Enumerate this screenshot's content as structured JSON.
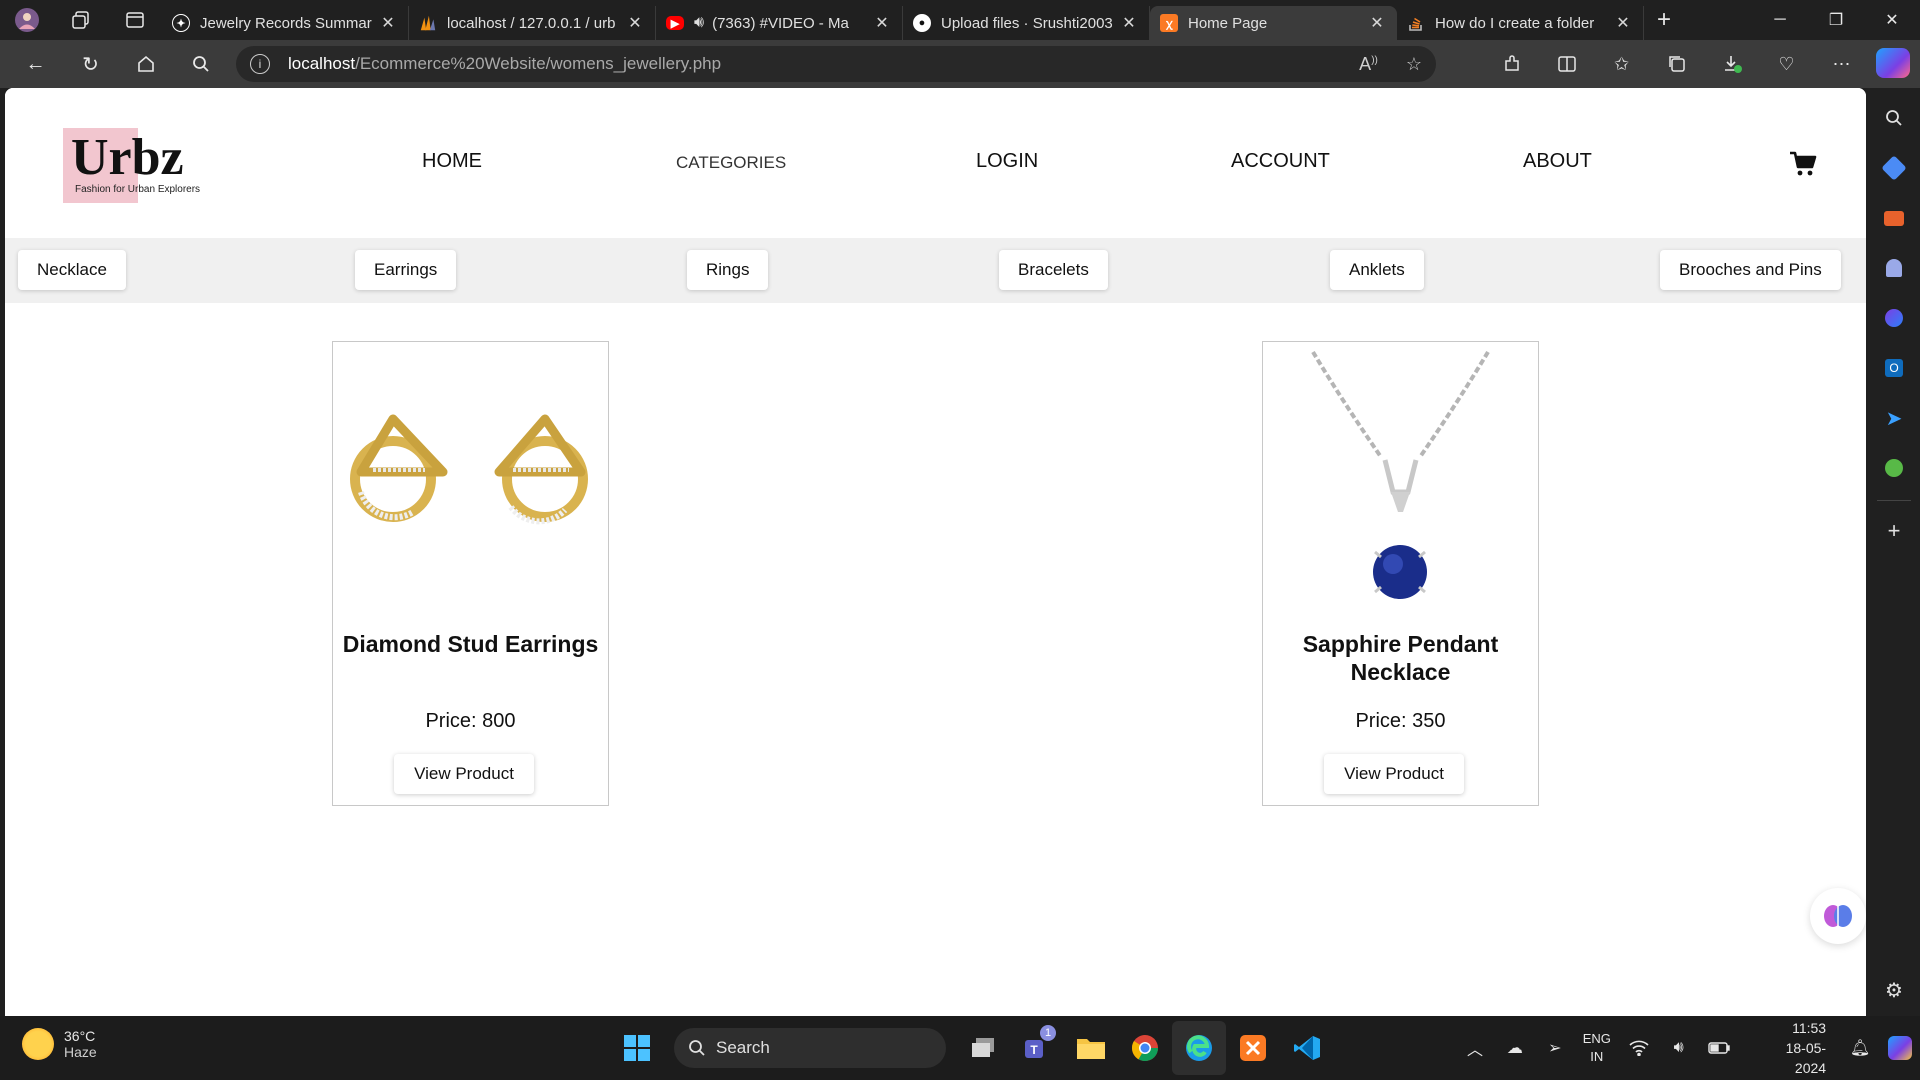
{
  "browser": {
    "tabs": [
      {
        "title": "Jewelry Records Summar",
        "icon": "chatgpt-icon",
        "color": "#ffffff"
      },
      {
        "title": "localhost / 127.0.0.1 / urb",
        "icon": "phpmyadmin-icon",
        "color": "#f29111"
      },
      {
        "title": "(7363) #VIDEO - Ma",
        "icon": "youtube-icon",
        "color": "#ff0000"
      },
      {
        "title": "Upload files · Srushti2003",
        "icon": "github-icon",
        "color": "#ffffff"
      },
      {
        "title": "Home Page",
        "icon": "xampp-icon",
        "color": "#fb7a24",
        "active": true
      },
      {
        "title": "How do I create a folder",
        "icon": "stackoverflow-icon",
        "color": "#f48024"
      }
    ],
    "address": {
      "host": "localhost",
      "path": "/Ecommerce%20Website/womens_jewellery.php"
    }
  },
  "site": {
    "logo": {
      "name": "Urbz",
      "tagline": "Fashion for Urban Explorers"
    },
    "nav": [
      "HOME",
      "CATEGORIES",
      "LOGIN",
      "ACCOUNT",
      "ABOUT"
    ],
    "categories": [
      "Necklace",
      "Earrings",
      "Rings",
      "Bracelets",
      "Anklets",
      "Brooches and Pins"
    ],
    "products": [
      {
        "name": "Diamond Stud Earrings",
        "price_label": "Price: 800",
        "button": "View Product"
      },
      {
        "name": "Sapphire Pendant Necklace",
        "price_label": "Price: 350",
        "button": "View Product"
      }
    ]
  },
  "taskbar": {
    "weather": {
      "temp": "36°C",
      "condition": "Haze"
    },
    "search_label": "Search",
    "teams_badge": "1",
    "language": {
      "line1": "ENG",
      "line2": "IN"
    },
    "clock": {
      "time": "11:53",
      "date": "18-05-2024"
    }
  }
}
